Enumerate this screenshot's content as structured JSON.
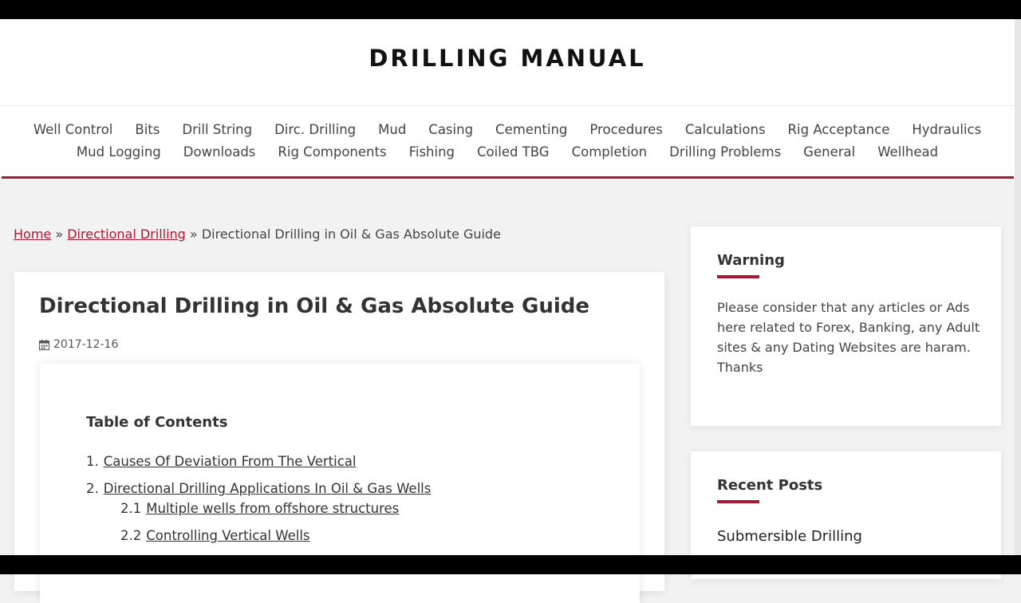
{
  "site": {
    "title": "DRILLING MANUAL"
  },
  "nav": {
    "row1": [
      "Well Control",
      "Bits",
      "Drill String",
      "Dirc. Drilling",
      "Mud",
      "Casing",
      "Cementing",
      "Procedures",
      "Calculations",
      "Rig Acceptance",
      "Hydraulics"
    ],
    "row2": [
      "Mud Logging",
      "Downloads",
      "Rig Components",
      "Fishing",
      "Coiled TBG",
      "Completion",
      "Drilling Problems",
      "General",
      "Wellhead"
    ]
  },
  "breadcrumb": {
    "home": "Home",
    "sep1": "»",
    "category": "Directional Drilling",
    "sep2": "»",
    "current": "Directional Drilling in Oil & Gas Absolute Guide"
  },
  "article": {
    "title": "Directional Drilling in Oil & Gas Absolute Guide",
    "date": "2017-12-16",
    "date_icon": "calendar-icon"
  },
  "toc": {
    "title": "Table of Contents",
    "items": [
      {
        "num": "1.",
        "label": "Causes Of Deviation From The Vertical"
      },
      {
        "num": "2.",
        "label": "Directional Drilling Applications In Oil & Gas Wells"
      },
      {
        "num": "2.1",
        "label": "Multiple wells from offshore structures"
      },
      {
        "num": "2.2",
        "label": "Controlling Vertical Wells"
      }
    ]
  },
  "sidebar": {
    "warning": {
      "title": "Warning",
      "text": "Please consider that any articles or Ads here related to Forex, Banking, any Adult sites & any Dating Websites are haram. Thanks"
    },
    "recent": {
      "title": "Recent Posts",
      "first_post": "Submersible Drilling"
    }
  },
  "colors": {
    "accent": "#a71930",
    "text": "#333333",
    "background": "#f2f2f2"
  }
}
